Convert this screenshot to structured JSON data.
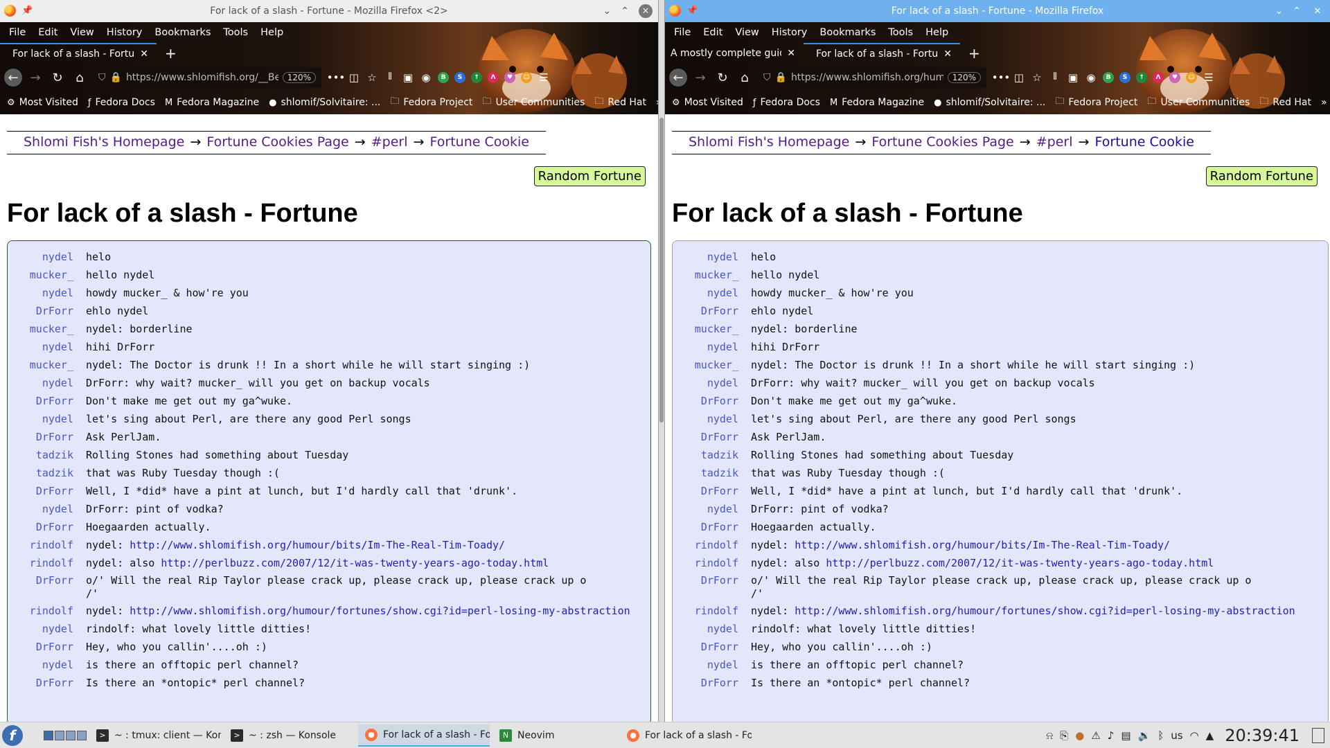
{
  "left_window": {
    "title": "For lack of a slash - Fortune - Mozilla Firefox <2>",
    "menu": [
      "File",
      "Edit",
      "View",
      "History",
      "Bookmarks",
      "Tools",
      "Help"
    ],
    "tabs": [
      {
        "label": "For lack of a slash - Fortu",
        "active": true
      }
    ],
    "url": "https://www.shlomifish.org/__Bet",
    "zoom": "120%"
  },
  "right_window": {
    "title": "For lack of a slash - Fortune - Mozilla Firefox",
    "menu": [
      "File",
      "Edit",
      "View",
      "History",
      "Bookmarks",
      "Tools",
      "Help"
    ],
    "tabs": [
      {
        "label": "A mostly complete guide to",
        "active": false
      },
      {
        "label": "For lack of a slash - Fortu",
        "active": true
      }
    ],
    "url": "https://www.shlomifish.org/humo",
    "zoom": "120%"
  },
  "bookmarks": [
    "Most Visited",
    "Fedora Docs",
    "Fedora Magazine",
    "shlomif/Solvitaire: ...",
    "Fedora Project",
    "User Communities",
    "Red Hat"
  ],
  "page": {
    "breadcrumb": [
      "Shlomi Fish's Homepage",
      "Fortune Cookies Page",
      "#perl",
      "Fortune Cookie"
    ],
    "arrow": "→",
    "random_button": "Random Fortune",
    "heading": "For lack of a slash - Fortune"
  },
  "irc_log": [
    {
      "nick": "nydel",
      "msg": "helo"
    },
    {
      "nick": "mucker_",
      "msg": "hello nydel"
    },
    {
      "nick": "nydel",
      "msg": "howdy mucker_ & how're you"
    },
    {
      "nick": "DrForr",
      "msg": "ehlo nydel"
    },
    {
      "nick": "mucker_",
      "msg": "nydel: borderline"
    },
    {
      "nick": "nydel",
      "msg": "hihi DrForr"
    },
    {
      "nick": "mucker_",
      "msg": "nydel: The Doctor is drunk !! In a short while he will start singing :)"
    },
    {
      "nick": "nydel",
      "msg": "DrForr: why wait? mucker_ will you get on backup vocals"
    },
    {
      "nick": "DrForr",
      "msg": "Don't make me get out my ga^wuke."
    },
    {
      "nick": "nydel",
      "msg": "let's sing about Perl, are there any good Perl songs"
    },
    {
      "nick": "DrForr",
      "msg": "Ask PerlJam."
    },
    {
      "nick": "tadzik",
      "msg": "Rolling Stones had something about Tuesday"
    },
    {
      "nick": "tadzik",
      "msg": "that was Ruby Tuesday though :("
    },
    {
      "nick": "DrForr",
      "msg": "Well, I *did* have a pint at lunch, but I'd hardly call that 'drunk'."
    },
    {
      "nick": "nydel",
      "msg": "DrForr: pint of vodka?"
    },
    {
      "nick": "DrForr",
      "msg": "Hoegaarden actually."
    },
    {
      "nick": "rindolf",
      "msg": "nydel: ",
      "link": "http://www.shlomifish.org/humour/bits/Im-The-Real-Tim-Toady/"
    },
    {
      "nick": "rindolf",
      "msg": "nydel: also ",
      "link": "http://perlbuzz.com/2007/12/it-was-twenty-years-ago-today.html"
    },
    {
      "nick": "DrForr",
      "msg": "o/' Will the real Rip Taylor please crack up, please crack up, please crack up o\n/'",
      "tall": true
    },
    {
      "nick": "rindolf",
      "msg": "nydel: ",
      "link": "http://www.shlomifish.org/humour/fortunes/show.cgi?id=perl-losing-my-abstraction",
      "tall": true
    },
    {
      "nick": "nydel",
      "msg": "rindolf: what lovely little ditties!"
    },
    {
      "nick": "DrForr",
      "msg": "Hey, who you callin'....oh :)"
    },
    {
      "nick": "nydel",
      "msg": "is there an offtopic perl channel?"
    },
    {
      "nick": "DrForr",
      "msg": "Is there an *ontopic* perl channel?"
    }
  ],
  "taskbar": {
    "tasks": [
      {
        "label": "~ : tmux: client — Konsole <...",
        "icon": "konsole-icon",
        "active": false
      },
      {
        "label": "~ : zsh — Konsole",
        "icon": "konsole-icon",
        "active": false
      },
      {
        "label": "For lack of a slash - Fortune -...",
        "icon": "firefox-icon",
        "active": true
      },
      {
        "label": "Neovim",
        "icon": "neovim-icon",
        "active": false
      },
      {
        "label": "For lack of a slash - Fortune -...",
        "icon": "firefox-icon",
        "active": false
      }
    ],
    "keyboard_layout": "us",
    "clock": "20:39:41"
  }
}
